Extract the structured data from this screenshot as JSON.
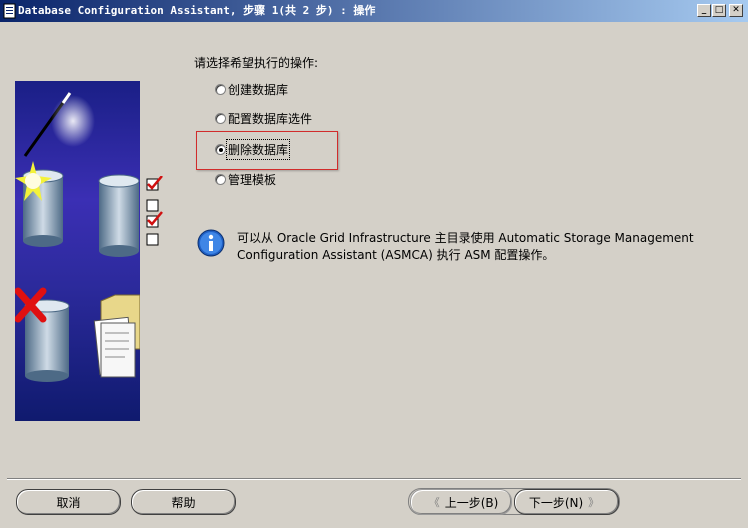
{
  "window": {
    "title": "Database Configuration Assistant, 步骤 1(共 2 步) : 操作",
    "minimize": "_",
    "maximize": "□",
    "close": "✕"
  },
  "main": {
    "prompt": "请选择希望执行的操作:",
    "options": [
      {
        "label": "创建数据库",
        "checked": false
      },
      {
        "label": "配置数据库选件",
        "checked": false
      },
      {
        "label": "删除数据库",
        "checked": true
      },
      {
        "label": "管理模板",
        "checked": false
      }
    ],
    "info_icon": "info-icon",
    "info_text": "可以从 Oracle Grid Infrastructure 主目录使用 Automatic Storage Management Configuration Assistant (ASMCA) 执行 ASM 配置操作。"
  },
  "buttons": {
    "cancel": "取消",
    "help": "帮助",
    "back": "上一步(B)",
    "next": "下一步(N)"
  },
  "colors": {
    "title_start": "#0a246a",
    "title_end": "#a6caf0",
    "highlight": "#d12b2b",
    "panel_blue": "#1c2a8c"
  }
}
